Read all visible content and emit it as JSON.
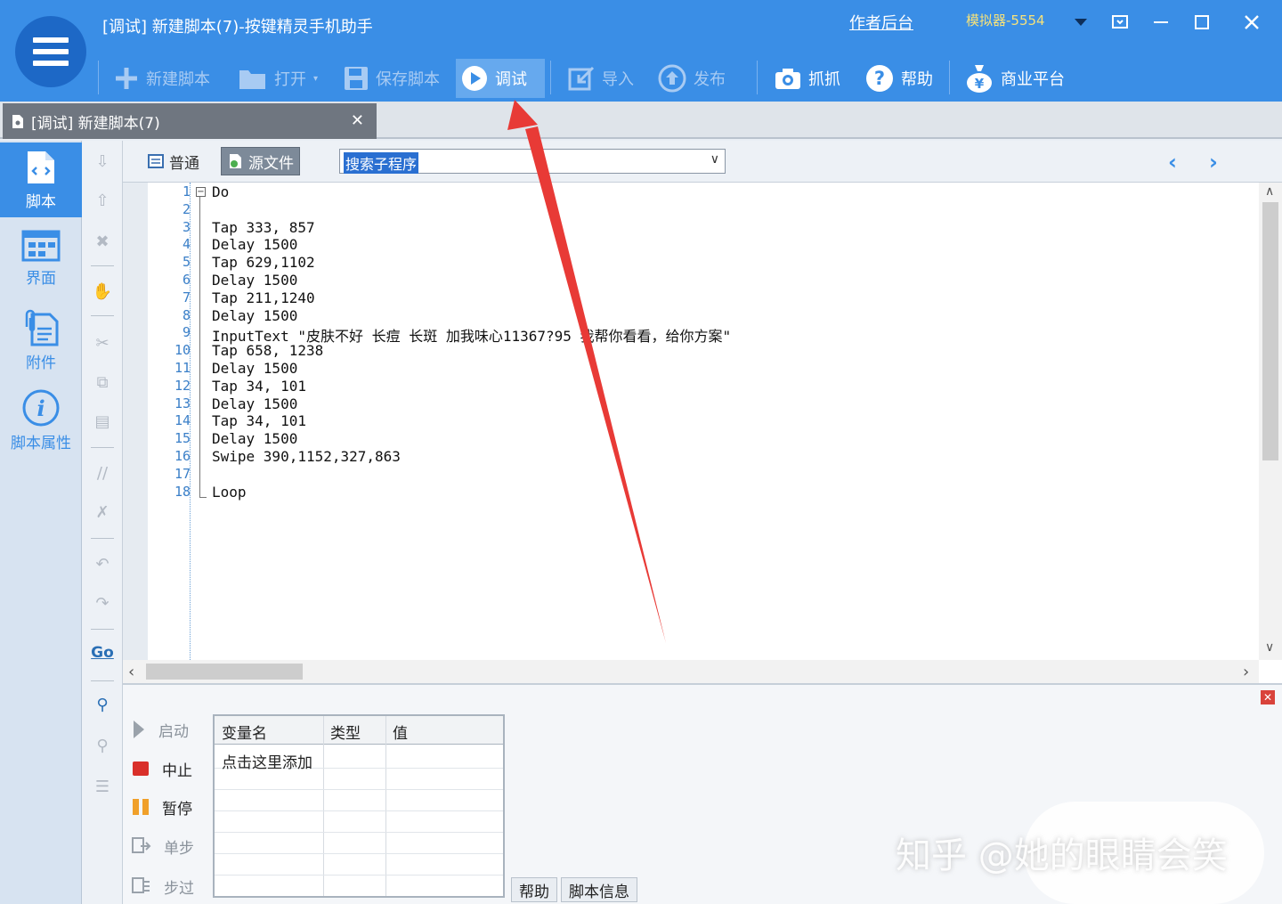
{
  "window": {
    "title": "[调试] 新建脚本(7)-按键精灵手机助手",
    "author_link": "作者后台",
    "emulator": "模拟器-5554"
  },
  "toolbar": {
    "new_script": "新建脚本",
    "open": "打开",
    "save_script": "保存脚本",
    "debug": "调试",
    "import": "导入",
    "publish": "发布",
    "capture": "抓抓",
    "help": "帮助",
    "business": "商业平台"
  },
  "doc_tab": {
    "label": "[调试] 新建脚本(7)"
  },
  "sidebar": {
    "items": [
      {
        "label": "脚本",
        "active": true
      },
      {
        "label": "界面"
      },
      {
        "label": "附件"
      },
      {
        "label": "脚本属性"
      }
    ]
  },
  "tool_column": {
    "goto_label": "Go"
  },
  "editor_toolbar": {
    "mode_normal": "普通",
    "mode_source": "源文件",
    "search_value": "搜索子程序"
  },
  "code": {
    "line_numbers": [
      "1",
      "2",
      "3",
      "4",
      "5",
      "6",
      "7",
      "8",
      "9",
      "10",
      "11",
      "12",
      "13",
      "14",
      "15",
      "16",
      "17",
      "18"
    ],
    "lines": [
      "Do",
      "",
      "Tap 333, 857",
      "Delay 1500",
      "Tap 629,1102",
      "Delay 1500",
      "Tap 211,1240",
      "Delay 1500",
      "InputText \"皮肤不好 长痘 长斑 加我味心11367?95 我帮你看看，给你方案\"",
      "Tap 658, 1238",
      "Delay 1500",
      "Tap 34, 101",
      "Delay 1500",
      "Tap 34, 101",
      "Delay 1500",
      "Swipe 390,1152,327,863",
      "",
      "Loop"
    ]
  },
  "debug_panel": {
    "controls": {
      "start": "启动",
      "stop": "中止",
      "pause": "暂停",
      "step": "单步",
      "step_over": "步过"
    },
    "var_table": {
      "columns": [
        "变量名",
        "类型",
        "值"
      ],
      "add_row": "点击这里添加"
    },
    "tabs": {
      "help": "帮助",
      "script_info": "脚本信息"
    }
  },
  "watermark": "知乎 @她的眼睛会笑",
  "colors": {
    "accent": "#3a8ee6",
    "annotation_arrow": "#e83a36"
  }
}
